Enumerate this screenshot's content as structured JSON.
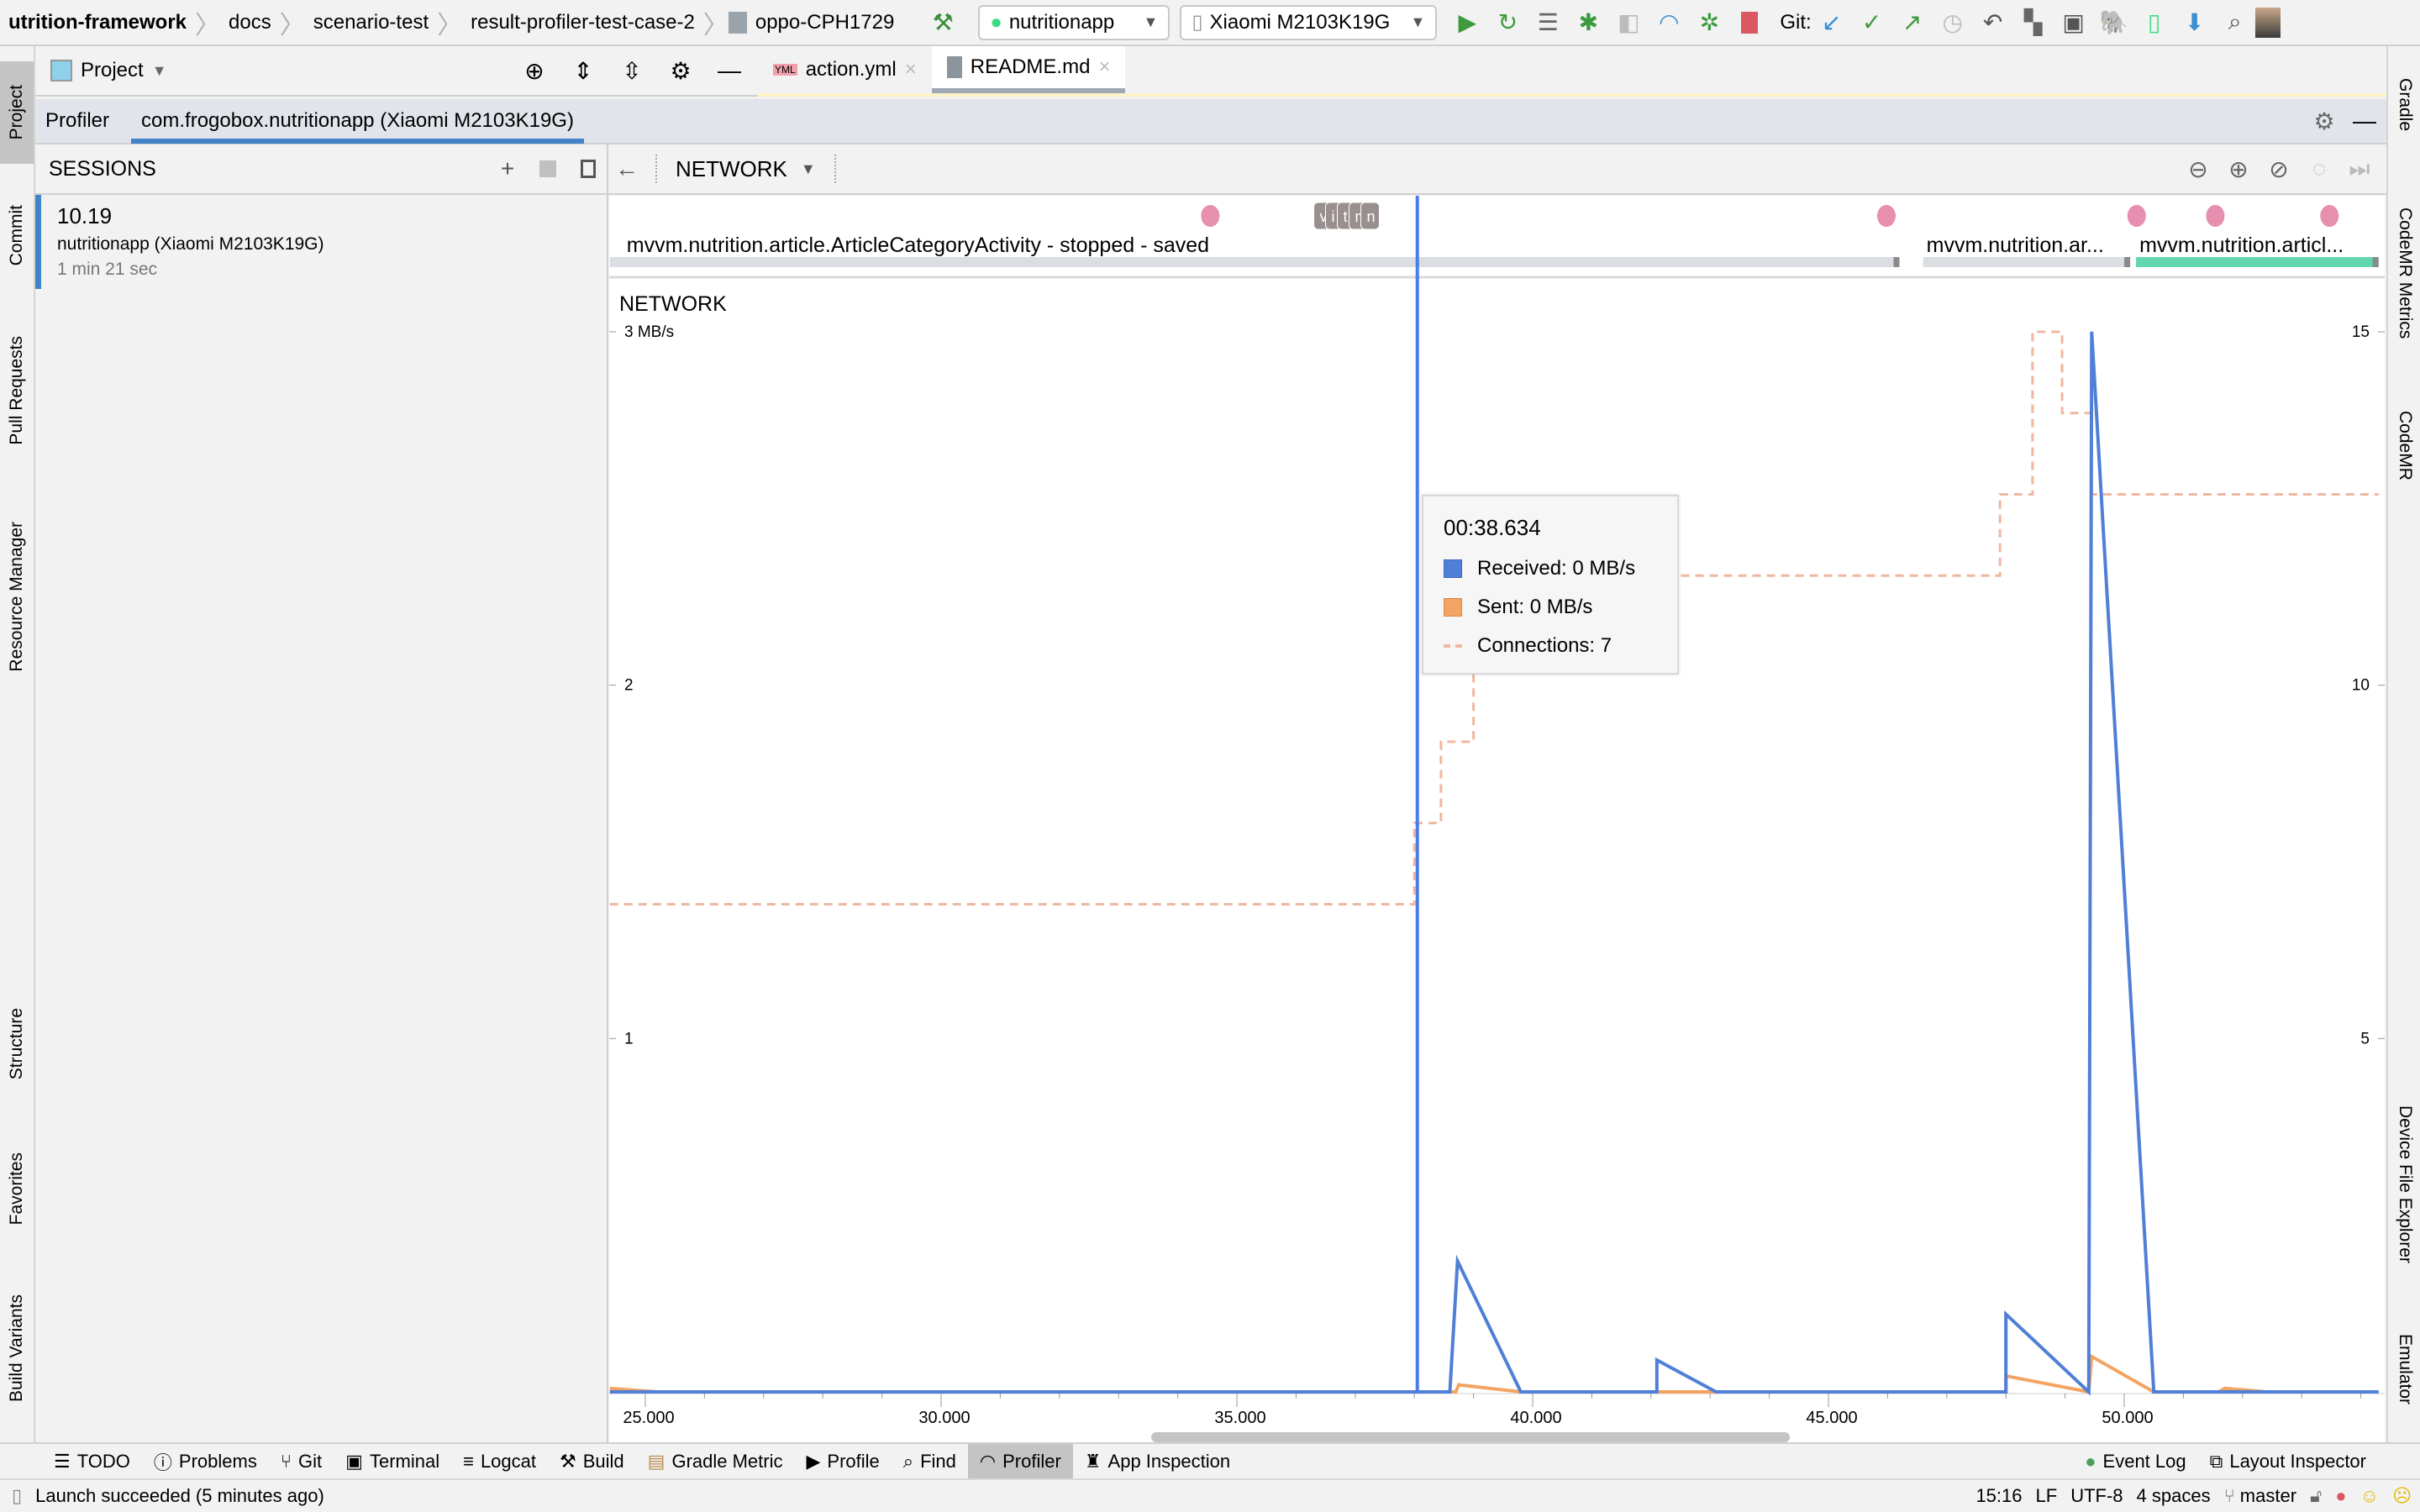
{
  "breadcrumbs": [
    "utrition-framework",
    "docs",
    "scenario-test",
    "result-profiler-test-case-2",
    "oppo-CPH1729"
  ],
  "toolbar": {
    "run_config": "nutritionapp",
    "device": "Xiaomi M2103K19G",
    "git_label": "Git:"
  },
  "project_panel": {
    "title": "Project"
  },
  "editor_tabs": [
    {
      "label": "action.yml",
      "icon": "yml-file-icon"
    },
    {
      "label": "README.md",
      "icon": "markdown-file-icon",
      "selected": true
    }
  ],
  "profiler_bar": {
    "label": "Profiler",
    "session_tab": "com.frogobox.nutritionapp (Xiaomi M2103K19G)"
  },
  "sessions": {
    "title": "SESSIONS",
    "items": [
      {
        "time": "10.19",
        "app": "nutritionapp (Xiaomi M2103K19G)",
        "duration": "1 min 21 sec"
      }
    ]
  },
  "network_header": {
    "title": "NETWORK"
  },
  "left_strip": [
    "Project",
    "Commit",
    "Pull Requests",
    "Resource Manager",
    "Structure",
    "Favorites",
    "Build Variants"
  ],
  "right_strip": [
    "Gradle",
    "CodeMR Metrics",
    "CodeMR",
    "Device File Explorer",
    "Emulator"
  ],
  "events": {
    "touch_times": [
      34.55,
      45.98,
      50.21,
      51.54,
      53.47
    ],
    "key_events": [
      "v",
      "i",
      "t",
      "m",
      "n"
    ],
    "activities": [
      {
        "label": "mvvm.nutrition.article.ArticleCategoryActivity - stopped - saved",
        "start": 24.4,
        "end": 46.2,
        "state": "stopped"
      },
      {
        "label": "mvvm.nutrition.ar...",
        "start": 46.6,
        "end": 50.1,
        "state": "stopped"
      },
      {
        "label": "mvvm.nutrition.articl...",
        "start": 50.2,
        "end": 54.3,
        "state": "active"
      }
    ]
  },
  "tooltip": {
    "time": "00:38.634",
    "received": "Received: 0 MB/s",
    "sent": "Sent: 0 MB/s",
    "connections": "Connections: 7"
  },
  "colors": {
    "received": "#4f7fd6",
    "sent": "#f3a463",
    "connections": "#f0b7a0",
    "cursor": "#4a7de8",
    "touch": "#e68fae",
    "active": "#62d6b0"
  },
  "chart_data": {
    "type": "line",
    "title": "NETWORK",
    "ylabel": "MB/s",
    "ylabel_right": "Connections",
    "xlim": [
      24.4,
      54.3
    ],
    "ylim": [
      0,
      3
    ],
    "ylim_right": [
      0,
      15
    ],
    "x_ticks": [
      "25.000",
      "30.000",
      "35.000",
      "40.000",
      "45.000",
      "50.000"
    ],
    "x_tick_values": [
      25,
      30,
      35,
      40,
      45,
      50
    ],
    "y_ticks": [
      {
        "v": 3,
        "label": "3 MB/s"
      },
      {
        "v": 2,
        "label": "2"
      },
      {
        "v": 1,
        "label": "1"
      }
    ],
    "y_ticks_right": [
      {
        "v": 15,
        "label": "15"
      },
      {
        "v": 10,
        "label": "10"
      },
      {
        "v": 5,
        "label": "5"
      }
    ],
    "cursor_time": 38.05,
    "series": [
      {
        "name": "Received",
        "points": [
          [
            24.4,
            0
          ],
          [
            38.6,
            0
          ],
          [
            38.73,
            0.37
          ],
          [
            39.8,
            0
          ],
          [
            42.1,
            0
          ],
          [
            42.1,
            0.09
          ],
          [
            43.1,
            0
          ],
          [
            48.0,
            0
          ],
          [
            48.0,
            0.22
          ],
          [
            49.4,
            0
          ],
          [
            49.45,
            3.0
          ],
          [
            50.5,
            0
          ],
          [
            54.3,
            0
          ]
        ]
      },
      {
        "name": "Sent",
        "points": [
          [
            24.4,
            0.01
          ],
          [
            25.2,
            0
          ],
          [
            38.7,
            0
          ],
          [
            38.75,
            0.02
          ],
          [
            39.8,
            0
          ],
          [
            48.0,
            0
          ],
          [
            48.0,
            0.045
          ],
          [
            49.4,
            0
          ],
          [
            49.45,
            0.1
          ],
          [
            50.5,
            0
          ],
          [
            51.6,
            0
          ],
          [
            51.7,
            0.01
          ],
          [
            52.4,
            0
          ],
          [
            54.3,
            0
          ]
        ]
      },
      {
        "name": "Connections",
        "step": true,
        "points": [
          [
            24.4,
            6.9
          ],
          [
            38.0,
            8.05
          ],
          [
            38.45,
            9.2
          ],
          [
            39.0,
            10.2
          ],
          [
            40.3,
            11.55
          ],
          [
            47.9,
            12.7
          ],
          [
            48.45,
            15
          ],
          [
            48.95,
            13.85
          ],
          [
            49.45,
            12.7
          ],
          [
            54.3,
            12.7
          ]
        ]
      }
    ]
  },
  "bottom_tools": [
    "TODO",
    "Problems",
    "Git",
    "Terminal",
    "Logcat",
    "Build",
    "Gradle Metric",
    "Profile",
    "Find",
    "Profiler",
    "App Inspection"
  ],
  "bottom_right": [
    "Event Log",
    "Layout Inspector"
  ],
  "status": {
    "message": "Launch succeeded (5 minutes ago)",
    "position": "15:16",
    "line_sep": "LF",
    "encoding": "UTF-8",
    "indent": "4 spaces",
    "branch": "master"
  }
}
